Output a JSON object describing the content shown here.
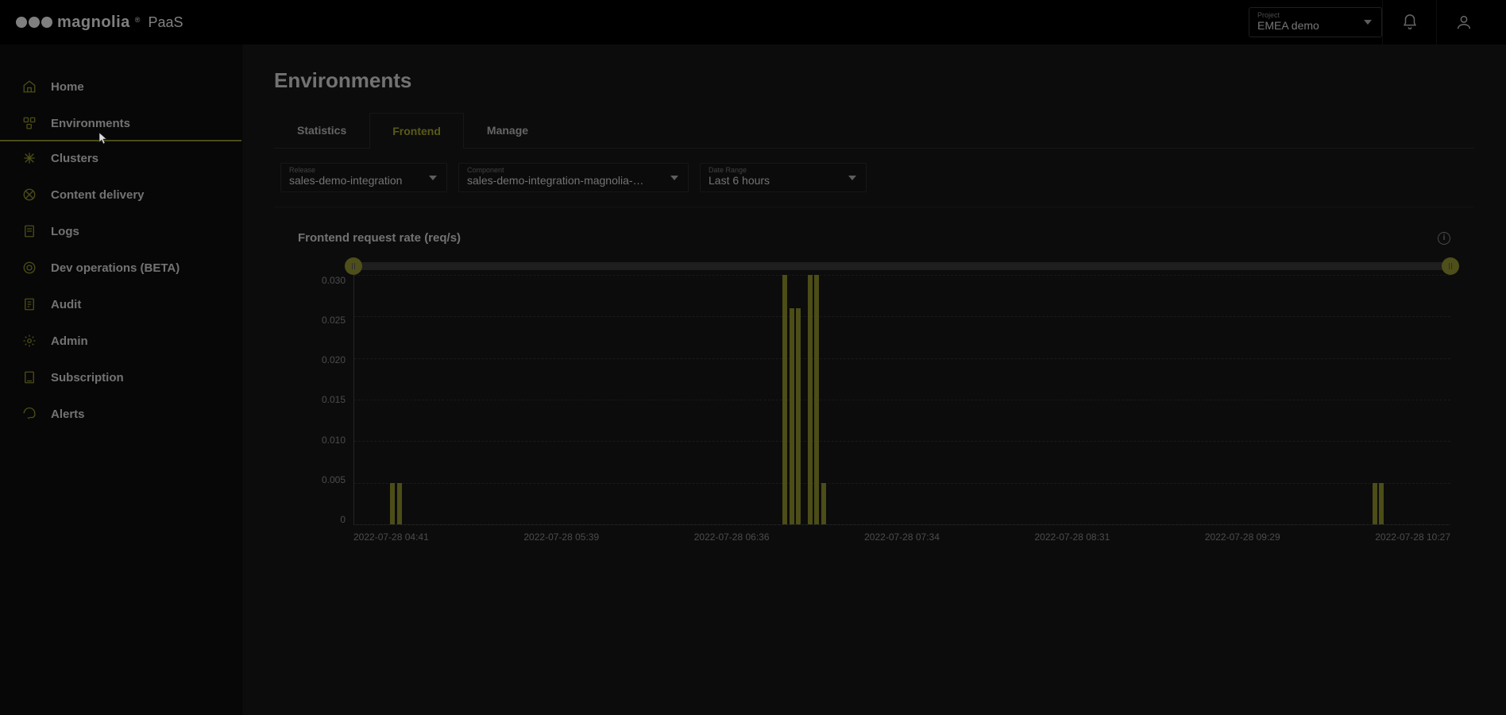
{
  "header": {
    "brand_word": "magnolia",
    "brand_suffix": "PaaS",
    "project_label": "Project",
    "project_value": "EMEA demo"
  },
  "sidebar": {
    "items": [
      {
        "label": "Home",
        "icon": "home"
      },
      {
        "label": "Environments",
        "icon": "environments",
        "active": true
      },
      {
        "label": "Clusters",
        "icon": "clusters"
      },
      {
        "label": "Content delivery",
        "icon": "content-delivery"
      },
      {
        "label": "Logs",
        "icon": "logs"
      },
      {
        "label": "Dev operations (BETA)",
        "icon": "dev-ops"
      },
      {
        "label": "Audit",
        "icon": "audit"
      },
      {
        "label": "Admin",
        "icon": "admin"
      },
      {
        "label": "Subscription",
        "icon": "subscription"
      },
      {
        "label": "Alerts",
        "icon": "alerts"
      }
    ]
  },
  "page": {
    "title": "Environments"
  },
  "tabs": [
    {
      "label": "Statistics"
    },
    {
      "label": "Frontend",
      "active": true
    },
    {
      "label": "Manage"
    }
  ],
  "filters": {
    "release_label": "Release",
    "release_value": "sales-demo-integration",
    "component_label": "Component",
    "component_value": "sales-demo-integration-magnolia-helm",
    "daterange_label": "Date Range",
    "daterange_value": "Last 6 hours"
  },
  "chart_title": "Frontend request rate (req/s)",
  "chart_data": {
    "type": "bar",
    "title": "Frontend request rate (req/s)",
    "xlabel": "",
    "ylabel": "",
    "ylim": [
      0,
      0.03
    ],
    "y_ticks": [
      "0.030",
      "0.025",
      "0.020",
      "0.015",
      "0.010",
      "0.005",
      "0"
    ],
    "x_ticks": [
      "2022-07-28 04:41",
      "2022-07-28 05:39",
      "2022-07-28 06:36",
      "2022-07-28 07:34",
      "2022-07-28 08:31",
      "2022-07-28 09:29",
      "2022-07-28 10:27"
    ],
    "bars": [
      {
        "pos_pct": 3.5,
        "value": 0.005
      },
      {
        "pos_pct": 4.1,
        "value": 0.005
      },
      {
        "pos_pct": 39.3,
        "value": 0.03
      },
      {
        "pos_pct": 39.9,
        "value": 0.026
      },
      {
        "pos_pct": 40.5,
        "value": 0.026
      },
      {
        "pos_pct": 41.6,
        "value": 0.03
      },
      {
        "pos_pct": 42.2,
        "value": 0.03
      },
      {
        "pos_pct": 42.8,
        "value": 0.005
      },
      {
        "pos_pct": 93.1,
        "value": 0.005
      },
      {
        "pos_pct": 93.7,
        "value": 0.005
      }
    ]
  }
}
